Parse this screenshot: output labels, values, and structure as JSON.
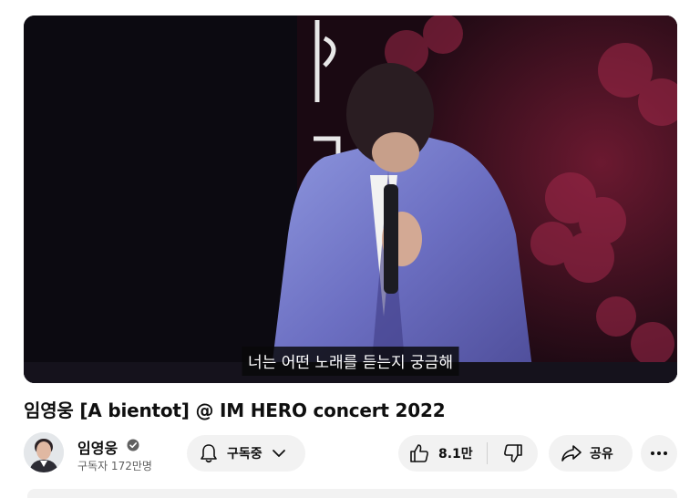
{
  "video": {
    "subtitle": "너는 어떤 노래를 듣는지 궁금해"
  },
  "title": "임영웅 [A bientot] @ IM HERO concert 2022",
  "channel": {
    "name": "임영웅",
    "subscribers": "구독자 172만명",
    "verified": true
  },
  "actions": {
    "subscribe_label": "구독중",
    "like_count": "8.1만",
    "share_label": "공유"
  },
  "icons": {
    "bell": "bell-icon",
    "chevron": "chevron-down-icon",
    "like": "thumbs-up-icon",
    "dislike": "thumbs-down-icon",
    "share": "share-icon",
    "more": "more-horizontal-icon"
  },
  "colors": {
    "pill_bg": "#f2f2f2",
    "text": "#0f0f0f",
    "secondary_text": "#606060"
  }
}
